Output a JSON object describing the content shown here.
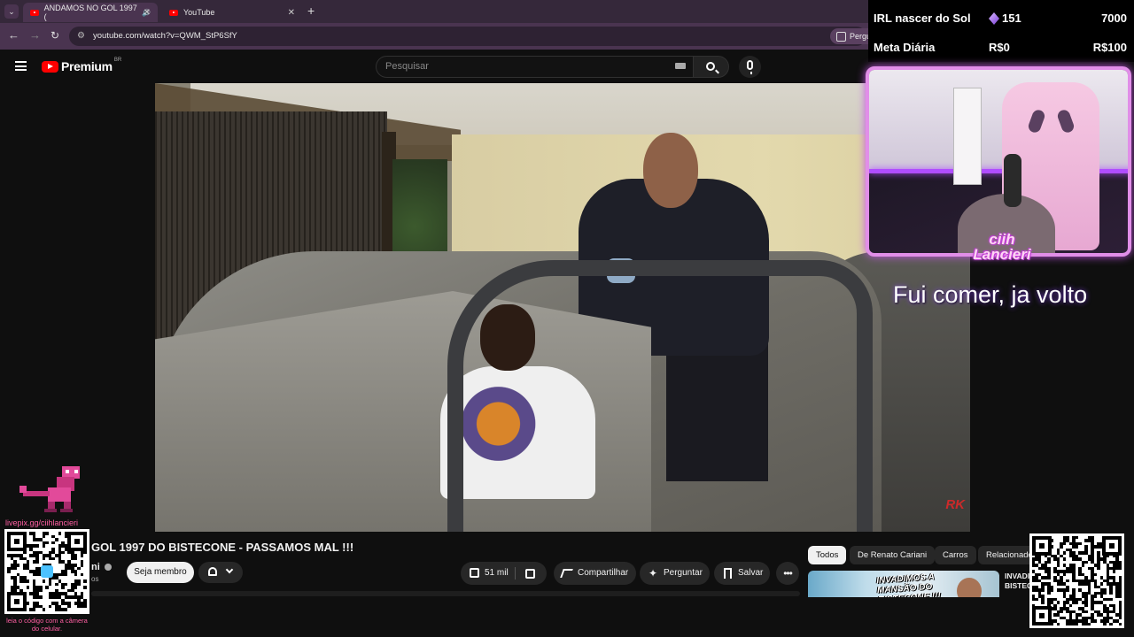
{
  "browser": {
    "tabs": [
      {
        "label": "ANDAMOS NO GOL 1997 (",
        "active": true
      },
      {
        "label": "YouTube",
        "active": false
      }
    ],
    "url": "youtube.com/watch?v=QWM_StP6SfY",
    "extension_chip": "Pergu"
  },
  "youtube": {
    "logo_text": "Premium",
    "logo_region": "BR",
    "search_placeholder": "Pesquisar"
  },
  "video": {
    "title": "GOL 1997 DO BISTECONE - PASSAMOS MAL !!!",
    "channel_fragment": "ni",
    "subs_fragment": "os",
    "member_button": "Seja membro",
    "likes": "51 mil",
    "share_label": "Compartilhar",
    "ask_label": "Perguntar",
    "save_label": "Salvar",
    "more_label": "•••",
    "watermark": "RK"
  },
  "recommendations": {
    "chips": [
      "Todos",
      "De Renato Cariani",
      "Carros",
      "Relacionados"
    ],
    "selected_chip": "Todos",
    "thumb_text": "INVADIMOS A MANSÃO DO BISTECONE !!!",
    "title_fragment": "INVADIM... BISTEC..."
  },
  "stream_overlay": {
    "goal_1": {
      "label": "IRL nascer do Sol",
      "count": "151",
      "target": "7000"
    },
    "goal_2": {
      "label": "Meta Diária",
      "current": "R$0",
      "target": "R$100"
    },
    "cam_name_line1": "ciih",
    "cam_name_line2": "Lancieri",
    "status_text": "Fui comer, ja volto",
    "livepix_url": "livepix.gg/ciihlancieri",
    "qr_caption": "leia o código com a câmera do celular."
  },
  "colors": {
    "accent_pink": "#ff5fa3",
    "cam_border": "#e18ee8",
    "yt_red": "#ff0000"
  }
}
